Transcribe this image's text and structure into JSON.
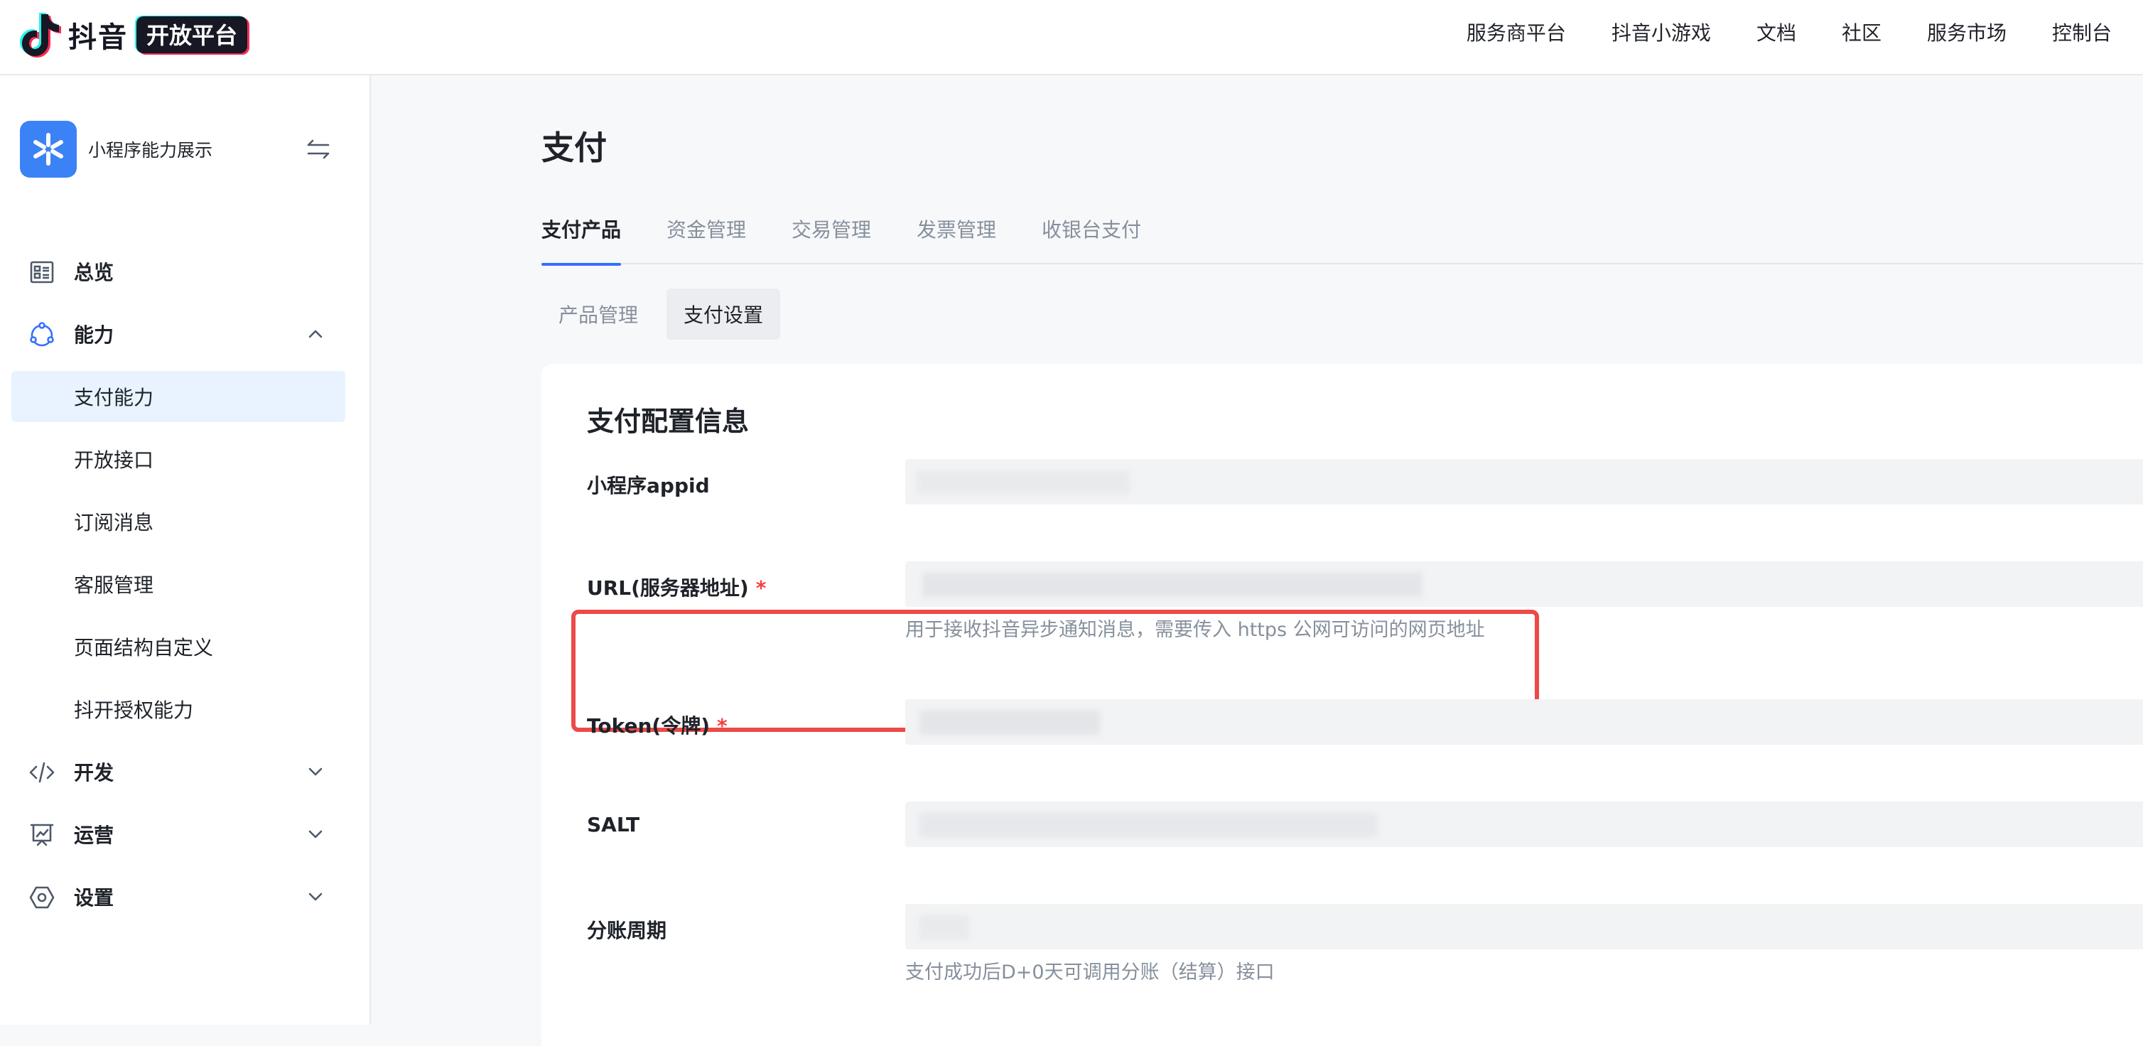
{
  "header": {
    "brand_name": "抖音",
    "brand_badge": "开放平台",
    "nav": [
      "服务商平台",
      "抖音小游戏",
      "文档",
      "社区",
      "服务市场",
      "控制台"
    ]
  },
  "sidebar": {
    "app_name": "小程序能力展示",
    "items": [
      {
        "label": "总览",
        "type": "group",
        "icon": "overview-icon"
      },
      {
        "label": "能力",
        "type": "group",
        "icon": "capability-icon",
        "expanded": true
      },
      {
        "label": "支付能力",
        "type": "sub",
        "active": true
      },
      {
        "label": "开放接口",
        "type": "sub"
      },
      {
        "label": "订阅消息",
        "type": "sub"
      },
      {
        "label": "客服管理",
        "type": "sub"
      },
      {
        "label": "页面结构自定义",
        "type": "sub"
      },
      {
        "label": "抖开授权能力",
        "type": "sub"
      },
      {
        "label": "开发",
        "type": "group",
        "icon": "code-icon",
        "expanded": false
      },
      {
        "label": "运营",
        "type": "group",
        "icon": "chart-board-icon",
        "expanded": false
      },
      {
        "label": "设置",
        "type": "group",
        "icon": "settings-icon",
        "expanded": false
      }
    ]
  },
  "main": {
    "title": "支付",
    "tabs": [
      {
        "label": "支付产品",
        "active": true
      },
      {
        "label": "资金管理"
      },
      {
        "label": "交易管理"
      },
      {
        "label": "发票管理"
      },
      {
        "label": "收银台支付"
      }
    ],
    "subtabs": [
      {
        "label": "产品管理"
      },
      {
        "label": "支付设置",
        "active": true
      }
    ],
    "card": {
      "title": "支付配置信息",
      "fields": [
        {
          "label": "小程序appid",
          "required": false,
          "hint": ""
        },
        {
          "label": "URL(服务器地址)",
          "required": true,
          "hint": "用于接收抖音异步通知消息，需要传入 https 公网可访问的网页地址"
        },
        {
          "label": "Token(令牌)",
          "required": true,
          "hint": ""
        },
        {
          "label": "SALT",
          "required": false,
          "hint": ""
        },
        {
          "label": "分账周期",
          "required": false,
          "hint": "支付成功后D+0天可调用分账（结算）接口"
        }
      ],
      "required_mark": "*"
    }
  },
  "colors": {
    "accent": "#3370ff",
    "highlight_border": "#ec4a48",
    "required": "#f53f3f",
    "active_bg": "#e8f3ff",
    "app_icon": "#3b82f6"
  }
}
